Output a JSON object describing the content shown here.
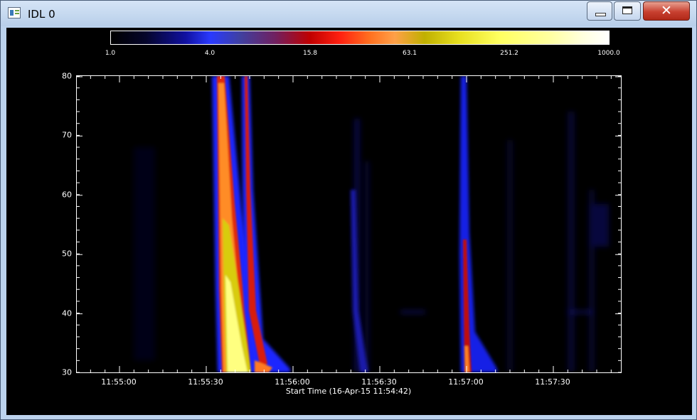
{
  "window": {
    "title": "IDL 0",
    "minimize_label": "minimize",
    "maximize_label": "maximize",
    "close_glyph": "✕"
  },
  "colorbar": {
    "tick_labels": [
      "1.0",
      "4.0",
      "15.8",
      "63.1",
      "251.2",
      "1000.0"
    ]
  },
  "chart_data": {
    "type": "heatmap",
    "title": "",
    "xlabel": "Start Time (16-Apr-15 11:54:42)",
    "ylabel": "",
    "x_tick_labels": [
      "11:55:00",
      "11:55:30",
      "11:56:00",
      "11:56:30",
      "11:57:00",
      "11:57:30"
    ],
    "y_tick_labels": [
      "30",
      "40",
      "50",
      "60",
      "70",
      "80"
    ],
    "ylim": [
      30,
      80
    ],
    "colorscale": "log",
    "color_range": [
      1.0,
      1000.0
    ],
    "colormap": [
      "#000000",
      "#1010a0",
      "#2a3aff",
      "#c00000",
      "#ff2010",
      "#ffa048",
      "#e8e020",
      "#ffffa0",
      "#ffffff"
    ]
  }
}
